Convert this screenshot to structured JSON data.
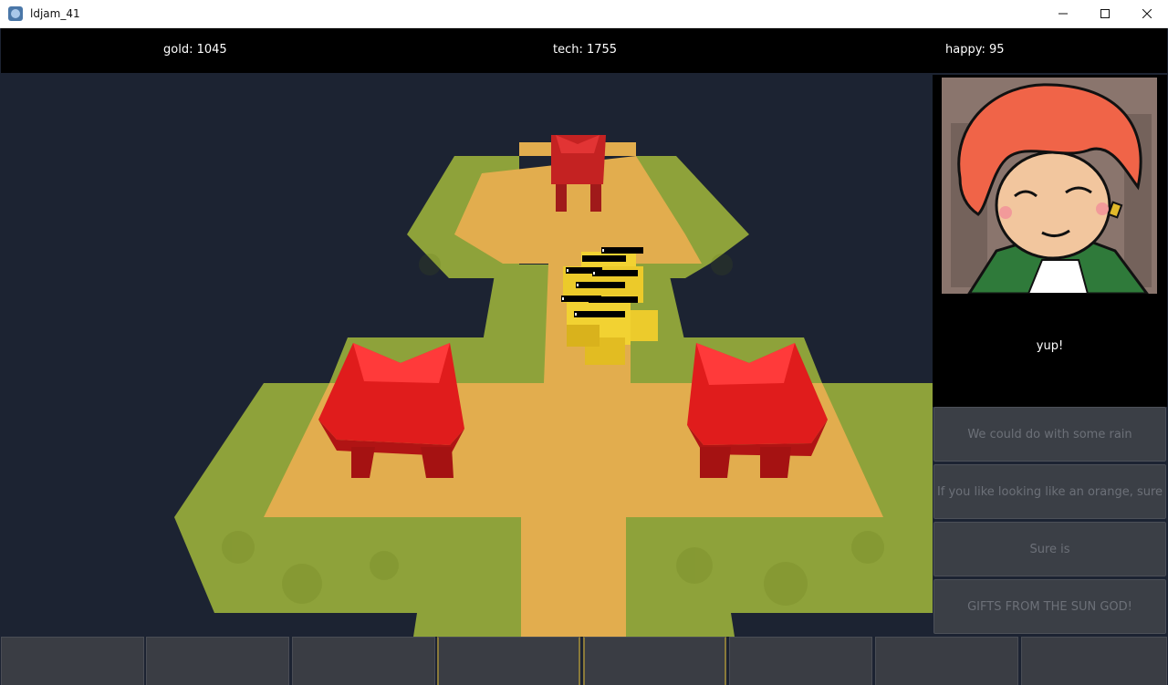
{
  "window": {
    "title": "ldjam_41"
  },
  "hud": {
    "gold": "gold: 1045",
    "tech": "tech: 1755",
    "happy": "happy: 95"
  },
  "dialogue": {
    "text": "yup!",
    "choices": [
      "We could do with some rain",
      "If you like looking like an orange, sure",
      "Sure is",
      "GIFTS FROM THE SUN GOD!"
    ]
  },
  "toolbar": {
    "slot_count": 8
  }
}
